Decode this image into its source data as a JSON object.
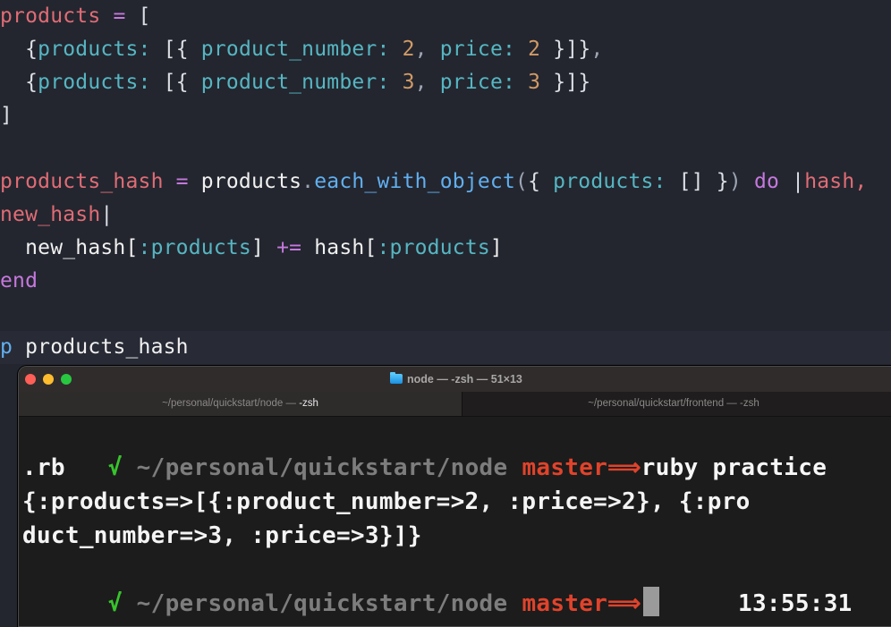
{
  "editor": {
    "lines": [
      [
        {
          "t": "products",
          "c": "t-var"
        },
        {
          "t": " = ",
          "c": "t-op"
        },
        {
          "t": "[",
          "c": "t-punc"
        }
      ],
      [
        {
          "t": "  {",
          "c": "t-punc"
        },
        {
          "t": "products:",
          "c": "t-sym"
        },
        {
          "t": " [{ ",
          "c": "t-punc"
        },
        {
          "t": "product_number:",
          "c": "t-sym"
        },
        {
          "t": " ",
          "c": "t-punc"
        },
        {
          "t": "2",
          "c": "t-num"
        },
        {
          "t": ", ",
          "c": "t-comma"
        },
        {
          "t": "price:",
          "c": "t-sym"
        },
        {
          "t": " ",
          "c": "t-punc"
        },
        {
          "t": "2",
          "c": "t-num"
        },
        {
          "t": " }]}",
          "c": "t-punc"
        },
        {
          "t": ",",
          "c": "t-comma"
        }
      ],
      [
        {
          "t": "  {",
          "c": "t-punc"
        },
        {
          "t": "products:",
          "c": "t-sym"
        },
        {
          "t": " [{ ",
          "c": "t-punc"
        },
        {
          "t": "product_number:",
          "c": "t-sym"
        },
        {
          "t": " ",
          "c": "t-punc"
        },
        {
          "t": "3",
          "c": "t-num"
        },
        {
          "t": ", ",
          "c": "t-comma"
        },
        {
          "t": "price:",
          "c": "t-sym"
        },
        {
          "t": " ",
          "c": "t-punc"
        },
        {
          "t": "3",
          "c": "t-num"
        },
        {
          "t": " }]}",
          "c": "t-punc"
        }
      ],
      [
        {
          "t": "]",
          "c": "t-punc"
        }
      ],
      [],
      [
        {
          "t": "products_hash",
          "c": "t-var"
        },
        {
          "t": " = ",
          "c": "t-op"
        },
        {
          "t": "products",
          "c": "t-id"
        },
        {
          "t": ".",
          "c": "t-comma"
        },
        {
          "t": "each_with_object",
          "c": "t-fn"
        },
        {
          "t": "(",
          "c": "t-paren"
        },
        {
          "t": "{ ",
          "c": "t-punc"
        },
        {
          "t": "products:",
          "c": "t-sym"
        },
        {
          "t": " [] }",
          "c": "t-punc"
        },
        {
          "t": ")",
          "c": "t-paren"
        },
        {
          "t": " do ",
          "c": "t-kw"
        },
        {
          "t": "|",
          "c": "t-punc"
        },
        {
          "t": "hash,",
          "c": "t-var"
        }
      ],
      [
        {
          "t": "new_hash",
          "c": "t-var"
        },
        {
          "t": "|",
          "c": "t-punc"
        }
      ],
      [
        {
          "t": "  new_hash[",
          "c": "t-id"
        },
        {
          "t": ":products",
          "c": "t-sym"
        },
        {
          "t": "]",
          "c": "t-id"
        },
        {
          "t": " += ",
          "c": "t-op"
        },
        {
          "t": "hash[",
          "c": "t-id"
        },
        {
          "t": ":products",
          "c": "t-sym"
        },
        {
          "t": "]",
          "c": "t-id"
        }
      ],
      [
        {
          "t": "end",
          "c": "t-kw"
        }
      ],
      [],
      [
        {
          "t": "p",
          "c": "t-fn"
        },
        {
          "t": " products_hash",
          "c": "t-id"
        }
      ]
    ],
    "current_line": 10
  },
  "terminal": {
    "window_title": "node — -zsh — 51×13",
    "tabs": [
      {
        "path": "~/personal/quickstart/node — ",
        "shell": "-zsh",
        "active": true
      },
      {
        "path": "~/personal/quickstart/frontend — ",
        "shell": "-zsh",
        "active": false
      }
    ],
    "prompt": {
      "check": "√",
      "path": "~/personal/quickstart/node",
      "branch": "master",
      "arrow": "⟹"
    },
    "command": "ruby practice",
    "output_lines": [
      ".rb",
      "{:products=>[{:product_number=>2, :price=>2}, {:pro",
      "duct_number=>3, :price=>3}]}"
    ],
    "clock": "13:55:31"
  }
}
